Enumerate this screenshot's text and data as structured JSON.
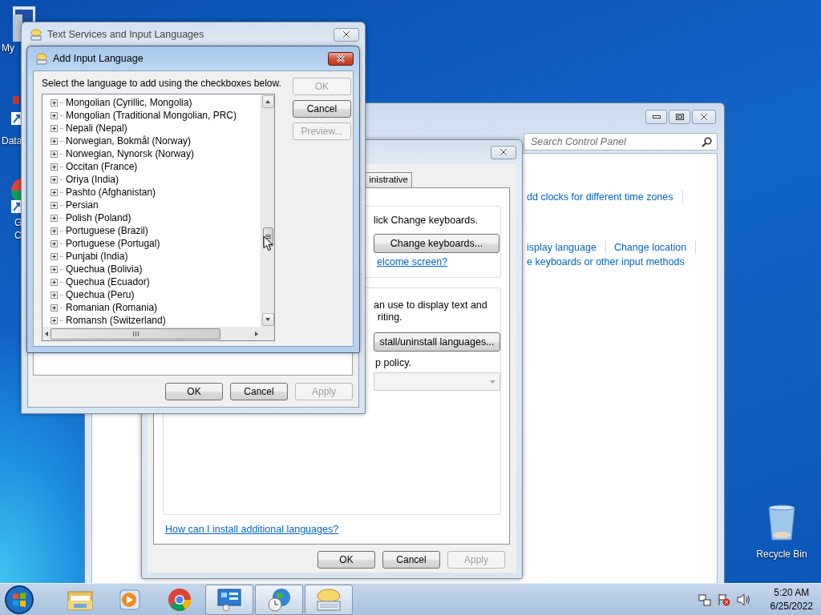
{
  "desktop_icons": [
    {
      "lines": [
        "My"
      ]
    },
    {
      "lines": [
        "Data"
      ]
    },
    {
      "lines": [
        "G",
        "C"
      ]
    }
  ],
  "recycle_bin": {
    "label": "Recycle Bin"
  },
  "control_panel": {
    "search": {
      "placeholder": "Search Control Panel"
    },
    "link_rows": [
      {
        "links": [
          "dd clocks for different time zones"
        ],
        "trailing_divider": true
      },
      {
        "links": [
          "isplay language",
          "Change location"
        ],
        "trailing_divider": true
      },
      {
        "links": [
          "e keyboards or other input methods"
        ],
        "trailing_divider": false
      }
    ]
  },
  "region_dialog": {
    "tabs": [
      {
        "label": "inistrative",
        "selected": false
      }
    ],
    "keyboards": {
      "text": "lick Change keyboards.",
      "button": "Change keyboards...",
      "link": "elcome screen?"
    },
    "display": {
      "lines": [
        "an use to display text and",
        "riting."
      ],
      "button": "stall/uninstall languages...",
      "policy": "p policy.",
      "dropdown_disabled": true
    },
    "help_link": "How can I install additional languages?",
    "buttons": [
      {
        "label": "OK",
        "disabled": false
      },
      {
        "label": "Cancel",
        "disabled": false
      },
      {
        "label": "Apply",
        "disabled": true
      }
    ]
  },
  "text_services": {
    "title": "Text Services and Input Languages",
    "buttons": [
      {
        "label": "OK",
        "disabled": false
      },
      {
        "label": "Cancel",
        "disabled": false
      },
      {
        "label": "Apply",
        "disabled": true
      }
    ]
  },
  "add_language": {
    "title": "Add Input Language",
    "instruction": "Select the language to add using the checkboxes below.",
    "languages": [
      {
        "label": "Mongolian (Cyrillic, Mongolia)",
        "expanded": false
      },
      {
        "label": "Mongolian (Traditional Mongolian, PRC)",
        "expanded": false
      },
      {
        "label": "Nepali (Nepal)",
        "expanded": false
      },
      {
        "label": "Norwegian, Bokmål (Norway)",
        "expanded": false
      },
      {
        "label": "Norwegian, Nynorsk (Norway)",
        "expanded": false
      },
      {
        "label": "Occitan (France)",
        "expanded": false
      },
      {
        "label": "Oriya (India)",
        "expanded": false
      },
      {
        "label": "Pashto (Afghanistan)",
        "expanded": false
      },
      {
        "label": "Persian",
        "expanded": false
      },
      {
        "label": "Polish (Poland)",
        "expanded": false
      },
      {
        "label": "Portuguese (Brazil)",
        "expanded": false
      },
      {
        "label": "Portuguese (Portugal)",
        "expanded": false
      },
      {
        "label": "Punjabi (India)",
        "expanded": false
      },
      {
        "label": "Quechua (Bolivia)",
        "expanded": false
      },
      {
        "label": "Quechua (Ecuador)",
        "expanded": false
      },
      {
        "label": "Quechua (Peru)",
        "expanded": false
      },
      {
        "label": "Romanian (Romania)",
        "expanded": false
      },
      {
        "label": "Romansh (Switzerland)",
        "expanded": false
      }
    ],
    "buttons": [
      {
        "label": "OK",
        "disabled": true
      },
      {
        "label": "Cancel",
        "disabled": false
      },
      {
        "label": "Preview...",
        "disabled": true
      }
    ]
  },
  "taskbar": {
    "items": [
      {
        "kind": "explorer",
        "running": false
      },
      {
        "kind": "media",
        "running": false
      },
      {
        "kind": "chrome",
        "running": false
      },
      {
        "kind": "control-panel",
        "running": true
      },
      {
        "kind": "globe",
        "running": true
      },
      {
        "kind": "keyboard",
        "running": true
      }
    ],
    "clock": {
      "time": "5:20 AM",
      "date": "6/25/2022"
    }
  }
}
